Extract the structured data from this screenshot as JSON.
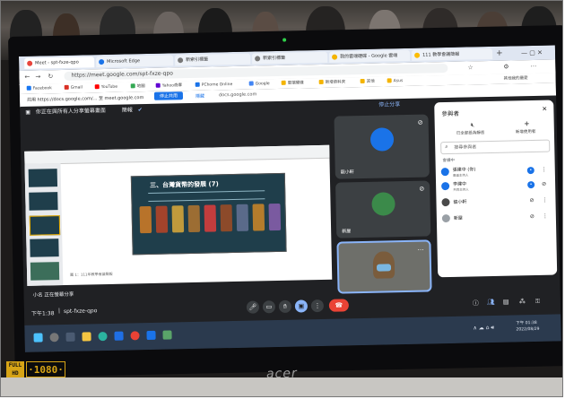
{
  "browser": {
    "tabs": [
      {
        "label": "Meet - spt-fxze-qpo",
        "active": true
      },
      {
        "label": "Microsoft Edge",
        "active": false
      },
      {
        "label": "新索引標籤",
        "active": false
      },
      {
        "label": "新索引標籤",
        "active": false
      },
      {
        "label": "我的雲端硬碟 - Google 雲端",
        "active": false
      },
      {
        "label": "111 教學會議簡報",
        "active": false
      }
    ],
    "url": "https://meet.google.com/spt-fxze-qpo",
    "bookmarks": [
      "Facebook",
      "Gmail",
      "YouTube",
      "地圖",
      "Yahoo奇摩",
      "PChome Online",
      "Google",
      "雲端硬碟",
      "新增資料夾",
      "其他",
      "Asus"
    ],
    "share_notice": "共用 https://docs.google.com/... 至 meet.google.com",
    "share_button": "停止共用",
    "share_hint": "隱藏",
    "share_domain": "docs.google.com",
    "other_bookmarks": "其他我的最愛"
  },
  "meet": {
    "presenting_notice": "你正在與所有人分享螢幕畫面",
    "stop_share_link": "停止分享",
    "presentation_bar": "簡報",
    "presenting_label": "小名 正在螢幕分享",
    "slide_title": "三、台灣貨幣的發展 (7)",
    "slide_caption": "圖 1：111年教學會議簡報",
    "tiles": [
      {
        "name": "龍小軒",
        "avatar_color": "#1a73e8"
      },
      {
        "name": "新屋",
        "avatar_color": "#3b8a4a"
      },
      {
        "name": "你",
        "avatar_color": "#7a5c3c"
      }
    ],
    "meeting_time": "下午1:38",
    "meeting_code": "spt-fxze-qpo"
  },
  "people_panel": {
    "title": "參與者",
    "add_people": "新增使用者",
    "share_label": "已全部設為靜音",
    "search_placeholder": "搜尋參與者",
    "section_label": "會議中",
    "participants": [
      {
        "name": "張建中 (你)",
        "sub": "會議主持人",
        "color": "#1a73e8"
      },
      {
        "name": "李建中",
        "sub": "共同主持人",
        "color": "#1a73e8"
      },
      {
        "name": "龍小軒",
        "sub": "",
        "color": "#4a4a4a"
      },
      {
        "name": "新屋",
        "sub": "",
        "color": "#9aa0a6"
      }
    ]
  },
  "taskbar": {
    "clock": "下午 01:38",
    "date": "2022/08/29"
  },
  "hd_badge": {
    "top": "FULL",
    "bottom": "HD",
    "resolution": "1080"
  },
  "brand": "acer"
}
